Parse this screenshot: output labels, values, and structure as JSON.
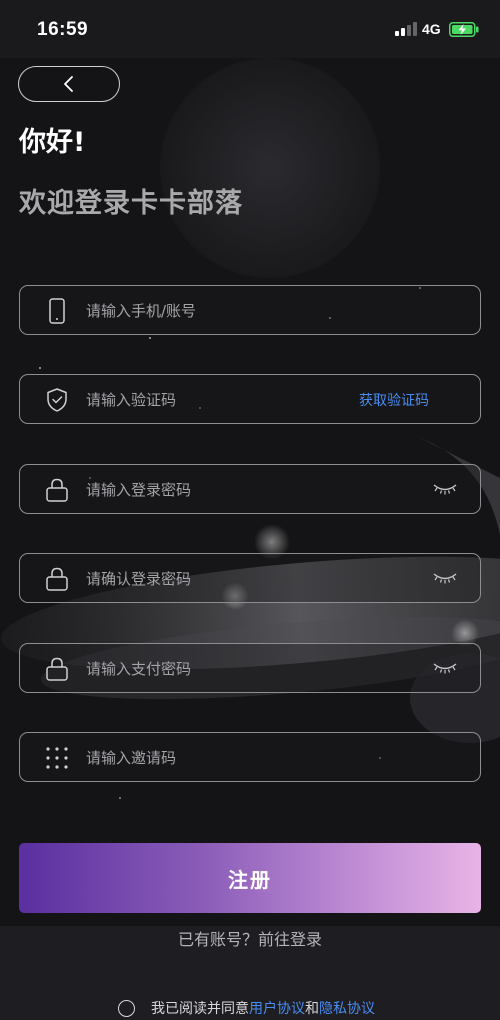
{
  "status_bar": {
    "time": "16:59",
    "network": "4G"
  },
  "header": {
    "greeting": "你好!",
    "welcome": "欢迎登录卡卡部落"
  },
  "form": {
    "phone_placeholder": "请输入手机/账号",
    "code_placeholder": "请输入验证码",
    "get_code_label": "获取验证码",
    "password_placeholder": "请输入登录密码",
    "confirm_password_placeholder": "请确认登录密码",
    "pay_password_placeholder": "请输入支付密码",
    "invite_placeholder": "请输入邀请码"
  },
  "actions": {
    "register_label": "注册",
    "login_link": "已有账号？前往登录"
  },
  "agreement": {
    "prefix": "我已阅读并同意",
    "user_agreement": "用户协议",
    "and": "和",
    "privacy_agreement": "隐私协议"
  },
  "icons": {
    "back": "chevron-left-icon",
    "phone": "phone-icon",
    "shield": "shield-check-icon",
    "lock": "lock-icon",
    "eye": "eye-closed-icon",
    "grid": "grid-dots-icon"
  },
  "colors": {
    "link": "#4a8cf0",
    "gradient_start": "#5a2f9f",
    "gradient_end": "#e8b4e6",
    "battery": "#4cd964"
  }
}
